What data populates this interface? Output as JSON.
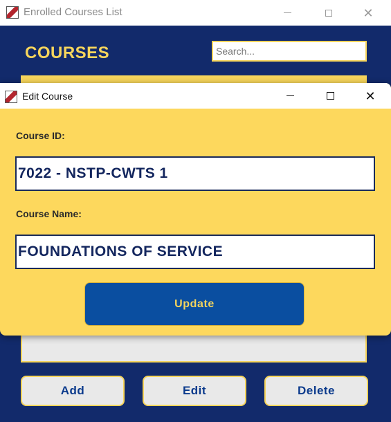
{
  "main_window": {
    "title": "Enrolled Courses List",
    "heading": "COURSES",
    "search": {
      "placeholder": "Search...",
      "value": ""
    },
    "buttons": {
      "add": "Add",
      "edit": "Edit",
      "delete": "Delete"
    }
  },
  "dialog": {
    "title": "Edit Course",
    "fields": {
      "course_id": {
        "label": "Course ID:",
        "value": "7022 - NSTP-CWTS 1"
      },
      "course_name": {
        "label": "Course Name:",
        "value": "FOUNDATIONS OF SERVICE"
      }
    },
    "update_button": "Update"
  },
  "window_controls": {
    "minimize": "minimize-icon",
    "maximize": "maximize-icon",
    "close": "close-icon"
  },
  "colors": {
    "navy": "#122a6b",
    "yellow": "#fdd85d",
    "accent_yellow": "#f6d55c",
    "button_blue": "#0a4ea0",
    "text_navy": "#13265e"
  }
}
